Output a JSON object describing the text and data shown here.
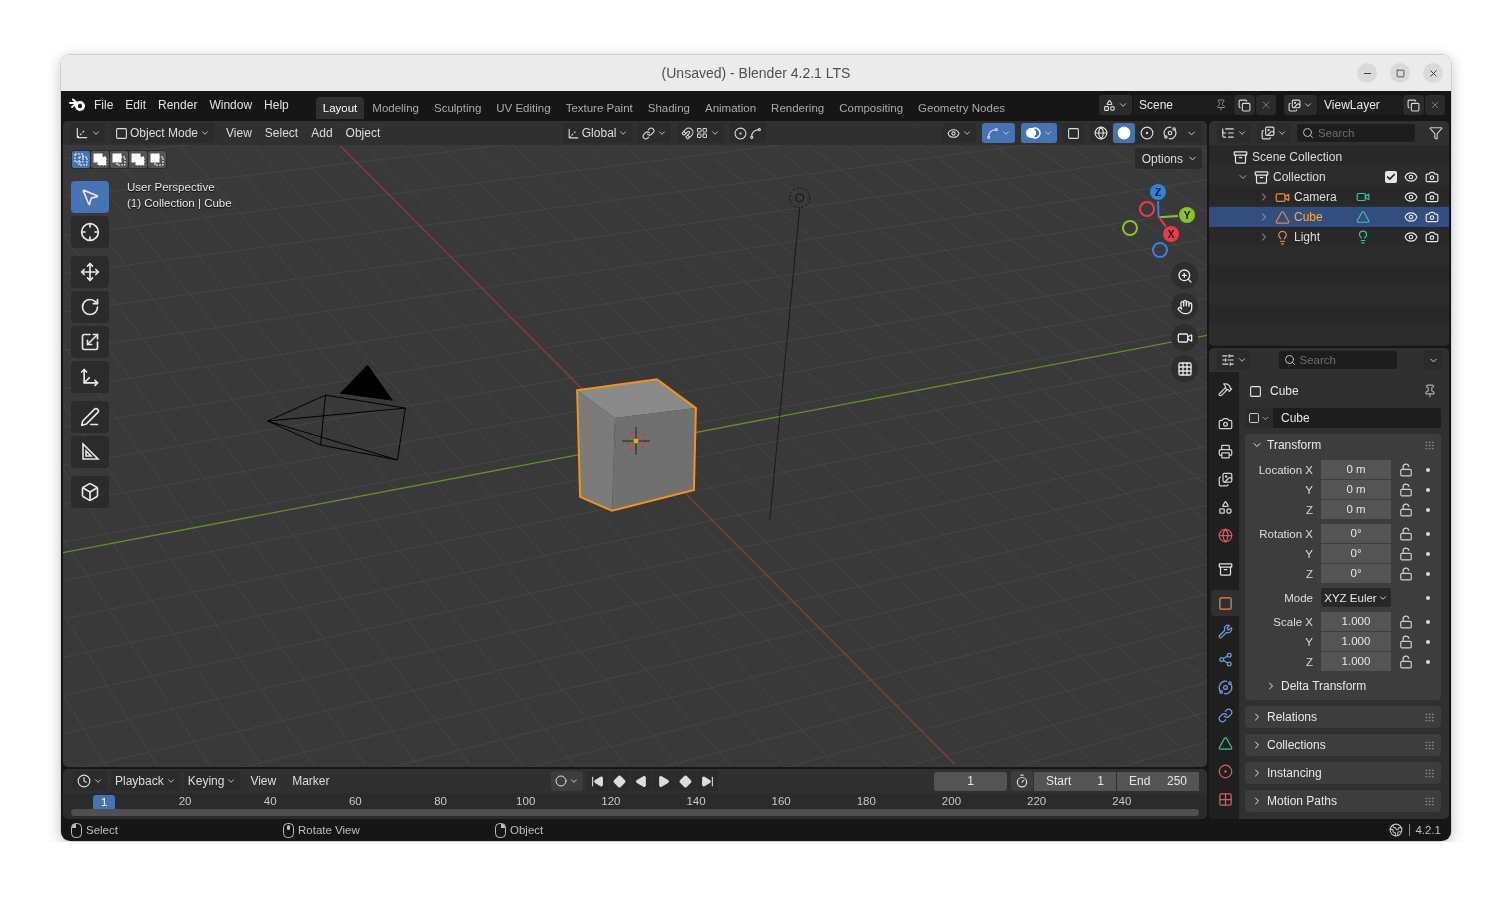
{
  "window": {
    "title": "(Unsaved) - Blender 4.2.1 LTS"
  },
  "menu": [
    "File",
    "Edit",
    "Render",
    "Window",
    "Help"
  ],
  "workspaces": [
    {
      "label": "Layout",
      "selected": true
    },
    {
      "label": "Modeling",
      "selected": false
    },
    {
      "label": "Sculpting",
      "selected": false
    },
    {
      "label": "UV Editing",
      "selected": false
    },
    {
      "label": "Texture Paint",
      "selected": false
    },
    {
      "label": "Shading",
      "selected": false
    },
    {
      "label": "Animation",
      "selected": false
    },
    {
      "label": "Rendering",
      "selected": false
    },
    {
      "label": "Compositing",
      "selected": false
    },
    {
      "label": "Geometry Nodes",
      "selected": false
    }
  ],
  "scene": "Scene",
  "view_layer": "ViewLayer",
  "viewport": {
    "mode": "Object Mode",
    "menus": [
      "View",
      "Select",
      "Add",
      "Object"
    ],
    "orientation": "Global",
    "toggles": [
      {
        "kind": "gizmos",
        "on": true
      },
      {
        "kind": "overlays",
        "on": true
      },
      {
        "kind": "xray",
        "on": false
      }
    ],
    "shading": [
      {
        "kind": "wireframe",
        "selected": false
      },
      {
        "kind": "solid",
        "selected": true
      },
      {
        "kind": "material",
        "selected": false
      },
      {
        "kind": "rendered",
        "selected": false
      }
    ],
    "select_modes": [
      {
        "kind": "set",
        "selected": true
      },
      {
        "kind": "extend",
        "selected": false
      },
      {
        "kind": "subtract",
        "selected": false
      },
      {
        "kind": "invert",
        "selected": false
      },
      {
        "kind": "intersect",
        "selected": false
      }
    ],
    "options": "Options",
    "info": [
      "User Perspective",
      "(1) Collection | Cube"
    ],
    "tool_groups": [
      [
        {
          "kind": "select",
          "selected": true
        },
        {
          "kind": "cursor",
          "selected": false
        }
      ],
      [
        {
          "kind": "move",
          "selected": false
        },
        {
          "kind": "rotate",
          "selected": false
        },
        {
          "kind": "scale",
          "selected": false
        },
        {
          "kind": "transform",
          "selected": false
        }
      ],
      [
        {
          "kind": "annotate",
          "selected": false
        },
        {
          "kind": "measure",
          "selected": false
        }
      ],
      [
        {
          "kind": "add_cube",
          "selected": false
        }
      ]
    ],
    "gizmo_axes": [
      {
        "label": "Z",
        "color": "#2f83e3"
      },
      {
        "label": "Y",
        "color": "#8bc128"
      },
      {
        "label": "X",
        "color": "#f2364e"
      }
    ]
  },
  "outliner": {
    "search": {
      "placeholder": "Search"
    },
    "tree": [
      {
        "label": "Scene Collection",
        "kind": "scene",
        "selected": false,
        "children": [
          {
            "label": "Collection",
            "kind": "collection",
            "selected": false,
            "expanded": true,
            "checked": true,
            "children": [
              {
                "label": "Camera",
                "kind": "camera",
                "selected": false,
                "expanded": false
              },
              {
                "label": "Cube",
                "kind": "mesh",
                "selected": true,
                "expanded": false
              },
              {
                "label": "Light",
                "kind": "light",
                "selected": false,
                "expanded": false
              }
            ]
          }
        ]
      }
    ]
  },
  "properties": {
    "search": {
      "placeholder": "Search"
    },
    "tab_groups": [
      [
        {
          "kind": "tool",
          "selected": false
        }
      ],
      [
        {
          "kind": "render",
          "selected": false
        },
        {
          "kind": "output",
          "selected": false
        },
        {
          "kind": "view_layer",
          "selected": false
        },
        {
          "kind": "scene",
          "selected": false
        },
        {
          "kind": "world",
          "selected": false
        }
      ],
      [
        {
          "kind": "collection",
          "selected": false
        }
      ],
      [
        {
          "kind": "object",
          "selected": true
        },
        {
          "kind": "modifiers",
          "selected": false
        },
        {
          "kind": "particles",
          "selected": false
        },
        {
          "kind": "physics",
          "selected": false
        },
        {
          "kind": "constraints",
          "selected": false
        },
        {
          "kind": "data",
          "selected": false
        },
        {
          "kind": "material",
          "selected": false
        },
        {
          "kind": "texture",
          "selected": false
        }
      ]
    ],
    "object_name": "Cube",
    "datablock": "Cube",
    "transform": {
      "title": "Transform",
      "expanded": true,
      "groups": [
        [
          {
            "label": "Location X",
            "value": "0 m",
            "kind": "number"
          },
          {
            "label": "Y",
            "value": "0 m",
            "kind": "number"
          },
          {
            "label": "Z",
            "value": "0 m",
            "kind": "number"
          }
        ],
        [
          {
            "label": "Rotation X",
            "value": "0°",
            "kind": "number"
          },
          {
            "label": "Y",
            "value": "0°",
            "kind": "number"
          },
          {
            "label": "Z",
            "value": "0°",
            "kind": "number"
          }
        ],
        [
          {
            "label": "Mode",
            "value": "XYZ Euler",
            "kind": "dropdown"
          }
        ],
        [
          {
            "label": "Scale X",
            "value": "1.000",
            "kind": "number"
          },
          {
            "label": "Y",
            "value": "1.000",
            "kind": "number"
          },
          {
            "label": "Z",
            "value": "1.000",
            "kind": "number"
          }
        ]
      ],
      "subpanels": [
        {
          "title": "Delta Transform",
          "expanded": false
        }
      ]
    },
    "panels": [
      {
        "title": "Relations",
        "expanded": false
      },
      {
        "title": "Collections",
        "expanded": false
      },
      {
        "title": "Instancing",
        "expanded": false
      },
      {
        "title": "Motion Paths",
        "expanded": false
      }
    ]
  },
  "timeline": {
    "menus": [
      {
        "label": "Playback",
        "dropdown": true
      },
      {
        "label": "Keying",
        "dropdown": true
      },
      {
        "label": "View",
        "dropdown": false
      },
      {
        "label": "Marker",
        "dropdown": false
      }
    ],
    "auto_keying": false,
    "current_frame": "1",
    "start": {
      "label": "Start",
      "value": "1"
    },
    "end": {
      "label": "End",
      "value": "250"
    },
    "playhead": "1",
    "ticks": [
      "20",
      "40",
      "60",
      "80",
      "100",
      "120",
      "140",
      "160",
      "180",
      "200",
      "220",
      "240"
    ]
  },
  "status_bar": {
    "hints": [
      {
        "label": "Select",
        "kind": "left"
      },
      {
        "label": "Rotate View",
        "kind": "middle"
      },
      {
        "label": "Object",
        "kind": "right"
      }
    ],
    "version": "4.2.1"
  }
}
